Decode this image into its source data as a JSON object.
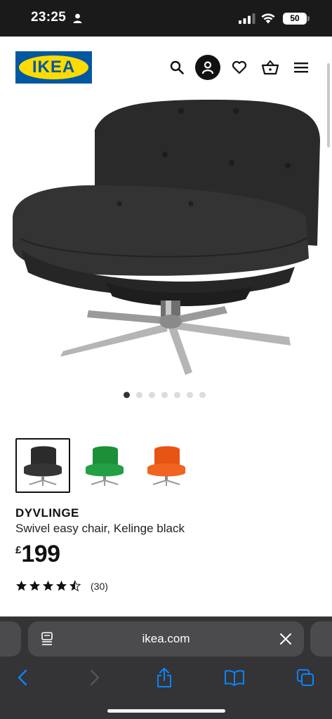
{
  "status_bar": {
    "time": "23:25",
    "battery": "50"
  },
  "header": {
    "logo_text": "IKEA",
    "icons": [
      "search-icon",
      "user-icon",
      "heart-icon",
      "basket-icon",
      "menu-icon"
    ]
  },
  "gallery": {
    "dot_count": 7,
    "active_index": 0
  },
  "variants": [
    "black",
    "green",
    "orange"
  ],
  "colors": {
    "brand_blue": "#0058a3",
    "brand_yellow": "#ffdb00",
    "variant_black": "#2b2b2b",
    "variant_green": "#1f9a3e",
    "variant_orange": "#ee5a17",
    "browser_accent": "#0a84ff"
  },
  "product": {
    "name": "DYVLINGE",
    "description": "Swivel easy chair, Kelinge black",
    "currency": "£",
    "price": "199",
    "rating": 4.5,
    "review_count": "(30)"
  },
  "browser": {
    "url": "ikea.com"
  }
}
